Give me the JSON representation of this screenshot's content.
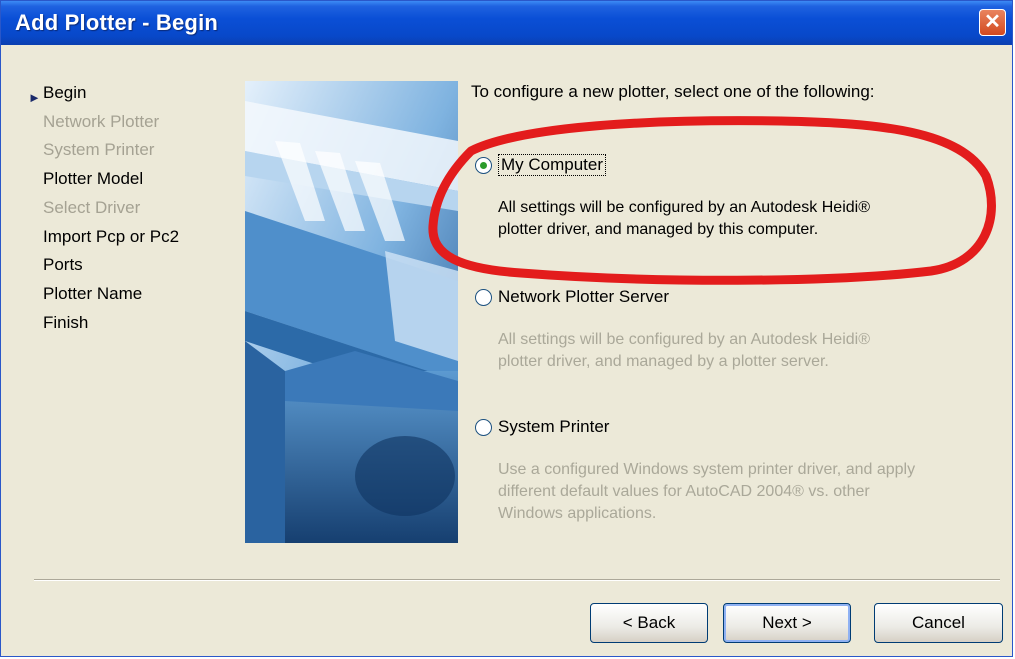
{
  "window": {
    "title": "Add Plotter - Begin",
    "close_glyph": "✕"
  },
  "steps": [
    {
      "label": "Begin",
      "state": "current"
    },
    {
      "label": "Network Plotter",
      "state": "disabled"
    },
    {
      "label": "System Printer",
      "state": "disabled"
    },
    {
      "label": "Plotter Model",
      "state": "active"
    },
    {
      "label": "Select Driver",
      "state": "disabled"
    },
    {
      "label": "Import Pcp or Pc2",
      "state": "active"
    },
    {
      "label": "Ports",
      "state": "active"
    },
    {
      "label": "Plotter Name",
      "state": "active"
    },
    {
      "label": "Finish",
      "state": "active"
    }
  ],
  "main": {
    "intro": "To configure a new plotter, select one of the following:",
    "options": [
      {
        "label": "My Computer",
        "selected": true,
        "description_lines": [
          "All settings will be configured by an Autodesk Heidi®",
          "plotter driver, and managed by this computer."
        ]
      },
      {
        "label": "Network Plotter Server",
        "selected": false,
        "description_lines": [
          "All settings will be configured by an Autodesk Heidi®",
          "plotter driver, and managed by a plotter server."
        ]
      },
      {
        "label": "System Printer",
        "selected": false,
        "description_lines": [
          "Use a configured Windows system printer driver, and apply",
          "different default values for AutoCAD 2004® vs. other",
          "Windows applications."
        ]
      }
    ]
  },
  "buttons": {
    "back": "< Back",
    "next": "Next >",
    "cancel": "Cancel"
  },
  "colors": {
    "title_bar": "#0a4fd6",
    "highlight_circle": "#e31c1c",
    "disabled_text": "#aaa899"
  }
}
